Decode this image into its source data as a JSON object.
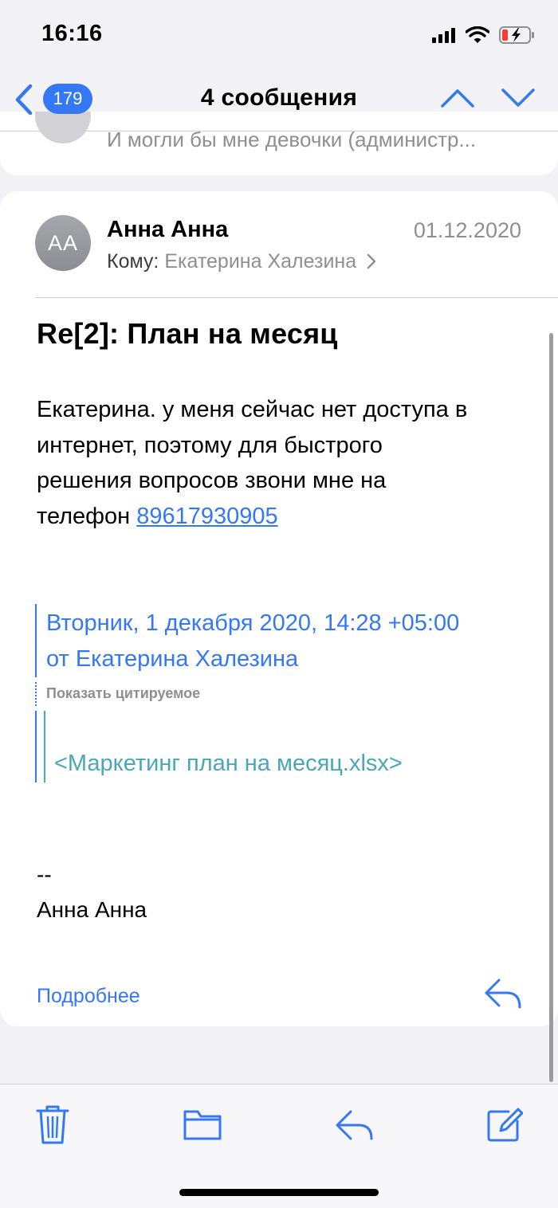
{
  "status_bar": {
    "time": "16:16",
    "icons": [
      "cellular-signal-icon",
      "wifi-icon",
      "battery-low-charging-icon"
    ]
  },
  "nav": {
    "back_icon": "chevron-left-icon",
    "unread_count": "179",
    "title": "4 сообщения",
    "up_icon": "chevron-up-icon",
    "down_icon": "chevron-down-icon"
  },
  "previous_message": {
    "snippet": "И могли бы мне девочки (администр..."
  },
  "message": {
    "avatar_initials": "AA",
    "sender": "Анна Анна",
    "date": "01.12.2020",
    "to_label": "Кому:",
    "to_name": "Екатерина Халезина",
    "subject": "Re[2]: План на месяц",
    "body_line1": "Екатерина. у меня сейчас нет доступа в",
    "body_line2": "интернет, поэтому для быстрого",
    "body_line3": "решения вопросов звони мне на",
    "body_line4_prefix": "телефон",
    "phone": "89617930905",
    "quote_header_line1": "Вторник, 1 декабря 2020, 14:28 +05:00",
    "quote_header_line2": "от Екатерина Халезина",
    "show_quoted": "Показать цитируемое",
    "attachment": "<Маркетинг план на месяц.xlsx>",
    "signature_dash": "--",
    "signature_name": "Анна Анна",
    "more_link": "Подробнее",
    "reply_icon": "reply-arrow-icon"
  },
  "toolbar": {
    "items": [
      "trash-icon",
      "folder-icon",
      "reply-icon",
      "compose-icon"
    ]
  },
  "colors": {
    "accent": "#3478f6",
    "quote_teal": "#4aa7b8",
    "secondary_text": "#8e8e93",
    "background": "#f2f2f7"
  }
}
